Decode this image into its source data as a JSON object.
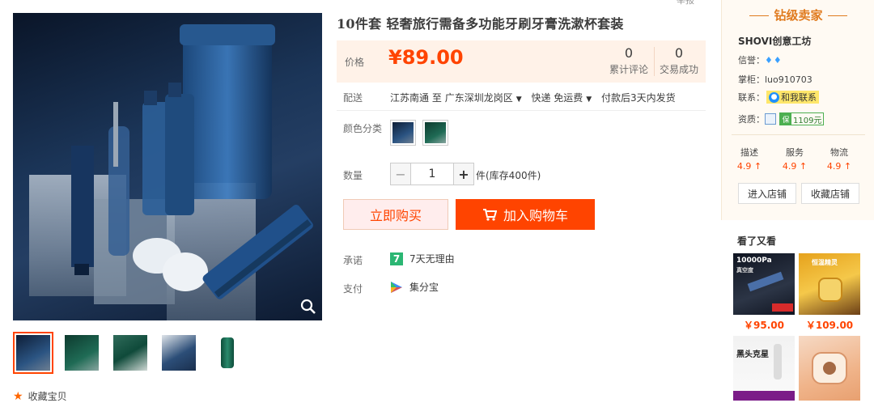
{
  "header": {
    "partial_top_text": "举报"
  },
  "product": {
    "title": "10件套 轻奢旅行需备多功能牙刷牙膏洗漱杯套装",
    "price_label": "价格",
    "price": "¥89.00",
    "stats": [
      {
        "value": "0",
        "label": "累计评论"
      },
      {
        "value": "0",
        "label": "交易成功"
      }
    ],
    "delivery": {
      "label": "配送",
      "from": "江苏南通",
      "to_word": "至",
      "to": "广东深圳龙岗区",
      "method": "快递 免运费",
      "ship_time": "付款后3天内发货"
    },
    "color_label": "颜色分类",
    "quantity_label": "数量",
    "quantity_value": "1",
    "minus": "−",
    "plus": "+",
    "stock": "件(库存400件)",
    "buy_now": "立即购买",
    "add_to_cart": "加入购物车",
    "promise_label": "承诺",
    "promise_badge": "7",
    "promise_text": "7天无理由",
    "pay_label": "支付",
    "pay_text": "集分宝",
    "favorite": "收藏宝贝"
  },
  "seller": {
    "level": "钻级卖家",
    "shop_name": "SHOVI创意工坊",
    "credit_label": "信誉：",
    "credit_gem": "♦",
    "owner_label": "掌柜：",
    "owner": "luo910703",
    "contact_label": "联系：",
    "contact_btn": "和我联系",
    "contact_dot": "●",
    "qual_label": "资质：",
    "deposit_badge": "保",
    "deposit": "1109元",
    "ratings": [
      {
        "label": "描述",
        "value": "4.9 ↑"
      },
      {
        "label": "服务",
        "value": "4.9 ↑"
      },
      {
        "label": "物流",
        "value": "4.9 ↑"
      }
    ],
    "enter_shop": "进入店铺",
    "fav_shop": "收藏店铺"
  },
  "also_viewed": {
    "title": "看了又看",
    "items": [
      {
        "price": "￥95.00",
        "img_text": "10000Pa",
        "img_sub": "真空度"
      },
      {
        "price": "￥109.00",
        "img_text": "恒温精灵"
      },
      {
        "img_text": "黑头克星"
      },
      {
        "img_text": ""
      }
    ]
  },
  "colors": {
    "accent": "#ff4400",
    "price_bg": "#fff2e8",
    "seller_title": "#e07b1f"
  }
}
